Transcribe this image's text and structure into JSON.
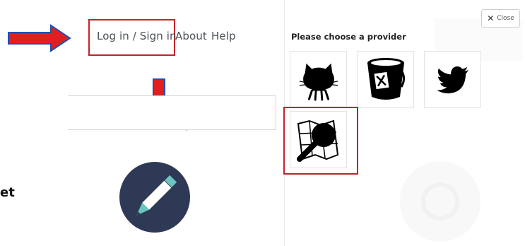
{
  "nav": {
    "login_label": "Log in / Sign in",
    "about_label": "About",
    "help_label": "Help"
  },
  "left": {
    "partial_text": "et"
  },
  "modal": {
    "close_label": "Close",
    "heading": "Please choose a provider",
    "providers": [
      {
        "icon": "github-icon"
      },
      {
        "icon": "bucket-icon"
      },
      {
        "icon": "twitter-icon"
      },
      {
        "icon": "map-search-icon"
      }
    ]
  },
  "colors": {
    "annotation_red": "#c8202a",
    "arrow_fill": "#e02020",
    "arrow_stroke": "#1f4fb0",
    "pencil_circle": "#2e3a55",
    "pencil_tip": "#6cc4c0"
  }
}
